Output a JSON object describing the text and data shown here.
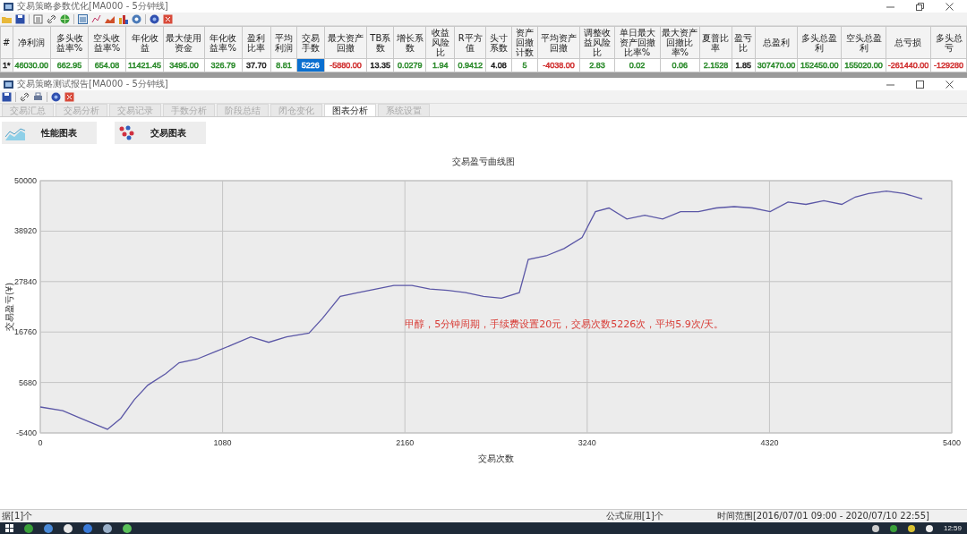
{
  "main_window": {
    "title": "交易策略参数优化[MA000 - 5分钟线]",
    "table": {
      "columns": [
        "#",
        "净利润",
        "多头收益率%",
        "空头收益率%",
        "年化收益",
        "最大使用资金",
        "年化收益率%",
        "盈利比率",
        "平均利润",
        "交易手数",
        "最大资产回撤",
        "TB系数",
        "增长系数",
        "收益风险比",
        "R平方值",
        "头寸系数",
        "资产回撤计数",
        "平均资产回撤",
        "调整收益风险比",
        "单日最大资产回撤比率%",
        "最大资产回撤比率%",
        "夏普比率",
        "盈亏比",
        "总盈利",
        "多头总盈利",
        "空头总盈利",
        "总亏损",
        "多头总亏"
      ],
      "rows": [
        {
          "cells": [
            {
              "text": "1*",
              "color": "#222222",
              "selected": false
            },
            {
              "text": "46030.00",
              "color": "#2a8a2a",
              "selected": false
            },
            {
              "text": "662.95",
              "color": "#2a8a2a",
              "selected": false
            },
            {
              "text": "654.08",
              "color": "#2a8a2a",
              "selected": false
            },
            {
              "text": "11421.45",
              "color": "#2a8a2a",
              "selected": false
            },
            {
              "text": "3495.00",
              "color": "#2a8a2a",
              "selected": false
            },
            {
              "text": "326.79",
              "color": "#2a8a2a",
              "selected": false
            },
            {
              "text": "37.70",
              "color": "#222222",
              "selected": false
            },
            {
              "text": "8.81",
              "color": "#2a8a2a",
              "selected": false
            },
            {
              "text": "5226",
              "selected": true
            },
            {
              "text": "-5880.00",
              "color": "#d03030",
              "selected": false
            },
            {
              "text": "13.35",
              "color": "#222222",
              "selected": false
            },
            {
              "text": "0.0279",
              "color": "#2a8a2a",
              "selected": false
            },
            {
              "text": "1.94",
              "color": "#2a8a2a",
              "selected": false
            },
            {
              "text": "0.9412",
              "color": "#2a8a2a",
              "selected": false
            },
            {
              "text": "4.08",
              "color": "#222222",
              "selected": false
            },
            {
              "text": "5",
              "color": "#2a8a2a",
              "selected": false
            },
            {
              "text": "-4038.00",
              "color": "#d03030",
              "selected": false
            },
            {
              "text": "2.83",
              "color": "#2a8a2a",
              "selected": false
            },
            {
              "text": "0.02",
              "color": "#2a8a2a",
              "selected": false
            },
            {
              "text": "0.06",
              "color": "#2a8a2a",
              "selected": false
            },
            {
              "text": "2.1528",
              "color": "#2a8a2a",
              "selected": false
            },
            {
              "text": "1.85",
              "color": "#222222",
              "selected": false
            },
            {
              "text": "307470.00",
              "color": "#2a8a2a",
              "selected": false
            },
            {
              "text": "152450.00",
              "color": "#2a8a2a",
              "selected": false
            },
            {
              "text": "155020.00",
              "color": "#2a8a2a",
              "selected": false
            },
            {
              "text": "-261440.00",
              "color": "#d03030",
              "selected": false
            },
            {
              "text": "-129280",
              "color": "#d03030",
              "selected": false
            }
          ]
        }
      ]
    }
  },
  "report_window": {
    "title": "交易策略测试报告[MA000 - 5分钟线]",
    "tabs": [
      {
        "label": "交易汇总",
        "selected": false
      },
      {
        "label": "交易分析",
        "selected": false
      },
      {
        "label": "交易记录",
        "selected": false
      },
      {
        "label": "手数分析",
        "selected": false
      },
      {
        "label": "阶段总结",
        "selected": false
      },
      {
        "label": "闭仓变化",
        "selected": false
      },
      {
        "label": "图表分析",
        "selected": true
      },
      {
        "label": "系统设置",
        "selected": false
      }
    ],
    "chart_buttons": [
      {
        "label": "性能图表",
        "kind": "area"
      },
      {
        "label": "交易图表",
        "kind": "scatter"
      }
    ],
    "chart_data": {
      "type": "line",
      "title": "交易盈亏曲线图",
      "xlabel": "交易次数",
      "ylabel": "交易盈亏(¥)",
      "x": [
        0,
        133,
        239,
        345,
        398,
        477,
        557,
        637,
        743,
        822,
        928,
        1034,
        1141,
        1247,
        1353,
        1459,
        1592,
        1671,
        1777,
        1883,
        1989,
        2095,
        2202,
        2308,
        2414,
        2520,
        2626,
        2732,
        2838,
        2891,
        2997,
        3103,
        3210,
        3289,
        3369,
        3475,
        3581,
        3687,
        3793,
        3899,
        4005,
        4111,
        4218,
        4324,
        4430,
        4536,
        4642,
        4748,
        4828,
        4907,
        5013,
        5119,
        5225
      ],
      "series": [
        {
          "color": "#5b57a6",
          "values": [
            300,
            -500,
            -2200,
            -3800,
            -4600,
            -2200,
            1900,
            5100,
            7600,
            10000,
            10800,
            12400,
            14000,
            15700,
            14500,
            15700,
            16500,
            19700,
            24600,
            25400,
            26200,
            27000,
            27000,
            26200,
            25900,
            25400,
            24600,
            24200,
            25400,
            32700,
            33500,
            35100,
            37500,
            43200,
            44000,
            41600,
            42400,
            41600,
            43200,
            43200,
            44000,
            44300,
            44000,
            43200,
            45300,
            44800,
            45600,
            44800,
            46400,
            47200,
            47700,
            47200,
            46000
          ]
        }
      ],
      "xlim": [
        0,
        5400
      ],
      "ylim": [
        -5400,
        50000
      ],
      "xticks": [
        0,
        1080,
        2160,
        3240,
        4320,
        5400
      ],
      "yticks": [
        -5400,
        5680,
        16760,
        27840,
        38920,
        50000
      ],
      "grid": true,
      "annotations": [
        "甲醇，5分钟周期，手续费设置20元，交易次数5226次，平均5.9次/天。"
      ]
    }
  },
  "status_bar": {
    "items": [
      "据[1]个",
      "公式应用[1]个",
      "时间范围[2016/07/01 09:00 - 2020/07/10 22:55]"
    ]
  },
  "taskbar": {
    "clock": "12:59"
  }
}
